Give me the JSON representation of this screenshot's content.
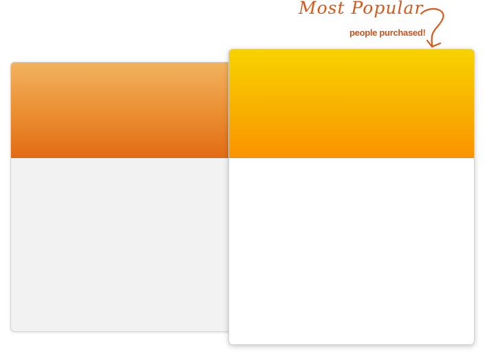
{
  "callout": {
    "title": "Most Popular",
    "subtitle": "people purchased!",
    "arrow_icon": "curved-arrow-down-icon"
  },
  "colors": {
    "left_header_top": "#f2b25e",
    "left_header_bottom": "#e36c15",
    "left_body": "#f2f2f2",
    "right_header_top": "#f8d200",
    "right_header_bottom": "#fb9300",
    "right_body": "#ffffff",
    "callout_text": "#d6581a"
  }
}
